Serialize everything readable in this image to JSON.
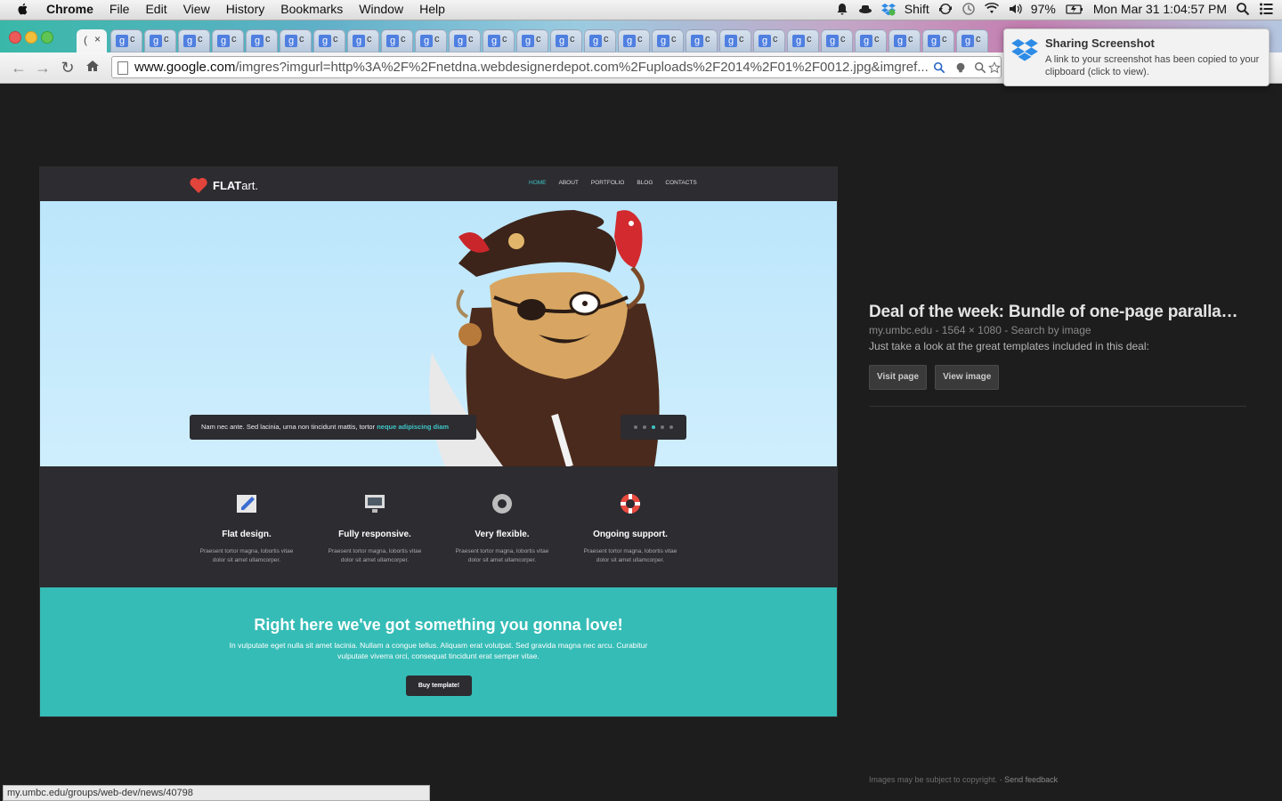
{
  "menubar": {
    "app_name": "Chrome",
    "items": [
      "File",
      "Edit",
      "View",
      "History",
      "Bookmarks",
      "Window",
      "Help"
    ],
    "status": {
      "shift_label": "Shift",
      "battery": "97%",
      "clock": "Mon Mar 31  1:04:57 PM"
    }
  },
  "tabs": {
    "active_label": "(",
    "favicon_letter": "g",
    "tab_letter": "c"
  },
  "toolbar": {
    "url_host": "www.google.com",
    "url_rest": "/imgres?imgurl=http%3A%2F%2Fnetdna.webdesignerdepot.com%2Fuploads%2F2014%2F01%2F0012.jpg&imgref..."
  },
  "notification": {
    "title": "Sharing Screenshot",
    "body": "A link to your screenshot has been copied to your clipboard (click to view)."
  },
  "preview": {
    "logo_bold": "FLAT",
    "logo_light": "art.",
    "nav": [
      "HOME",
      "ABOUT",
      "PORTFOLIO",
      "BLOG",
      "CONTACTS"
    ],
    "caption_text": "Nam nec ante. Sed lacinia, urna non tincidunt mattis, tortor ",
    "caption_link": "neque adipiscing diam",
    "features": [
      {
        "title": "Flat design.",
        "desc": "Praesent tortor magna, lobortis vitae dolor sit amet ullamcorper."
      },
      {
        "title": "Fully responsive.",
        "desc": "Praesent tortor magna, lobortis vitae dolor sit amet ullamcorper."
      },
      {
        "title": "Very flexible.",
        "desc": "Praesent tortor magna, lobortis vitae dolor sit amet ullamcorper."
      },
      {
        "title": "Ongoing support.",
        "desc": "Praesent tortor magna, lobortis vitae dolor sit amet ullamcorper."
      }
    ],
    "cta_heading": "Right here we've got something you gonna love!",
    "cta_text": "In vulputate eget nulla sit amet lacinia. Nullam a congue tellus. Aliquam erat volutpat. Sed gravida magna nec arcu. Curabitur vulputate viverra orci, consequat tincidunt erat semper vitae.",
    "cta_button": "Buy template!"
  },
  "info": {
    "title": "Deal of the week: Bundle of one-page paralla…",
    "meta": "my.umbc.edu - 1564 × 1080 - Search by image",
    "desc": "Just take a look at the great templates included in this deal:",
    "visit_button": "Visit page",
    "view_button": "View image"
  },
  "footer": {
    "copyright": "Images may be subject to copyright. - ",
    "feedback": "Send feedback"
  },
  "status_url": "my.umbc.edu/groups/web-dev/news/40798",
  "colors": {
    "accent": "#3fc4c5",
    "cta_bg": "#35bcb6",
    "page_bg": "#1d1d1d"
  }
}
